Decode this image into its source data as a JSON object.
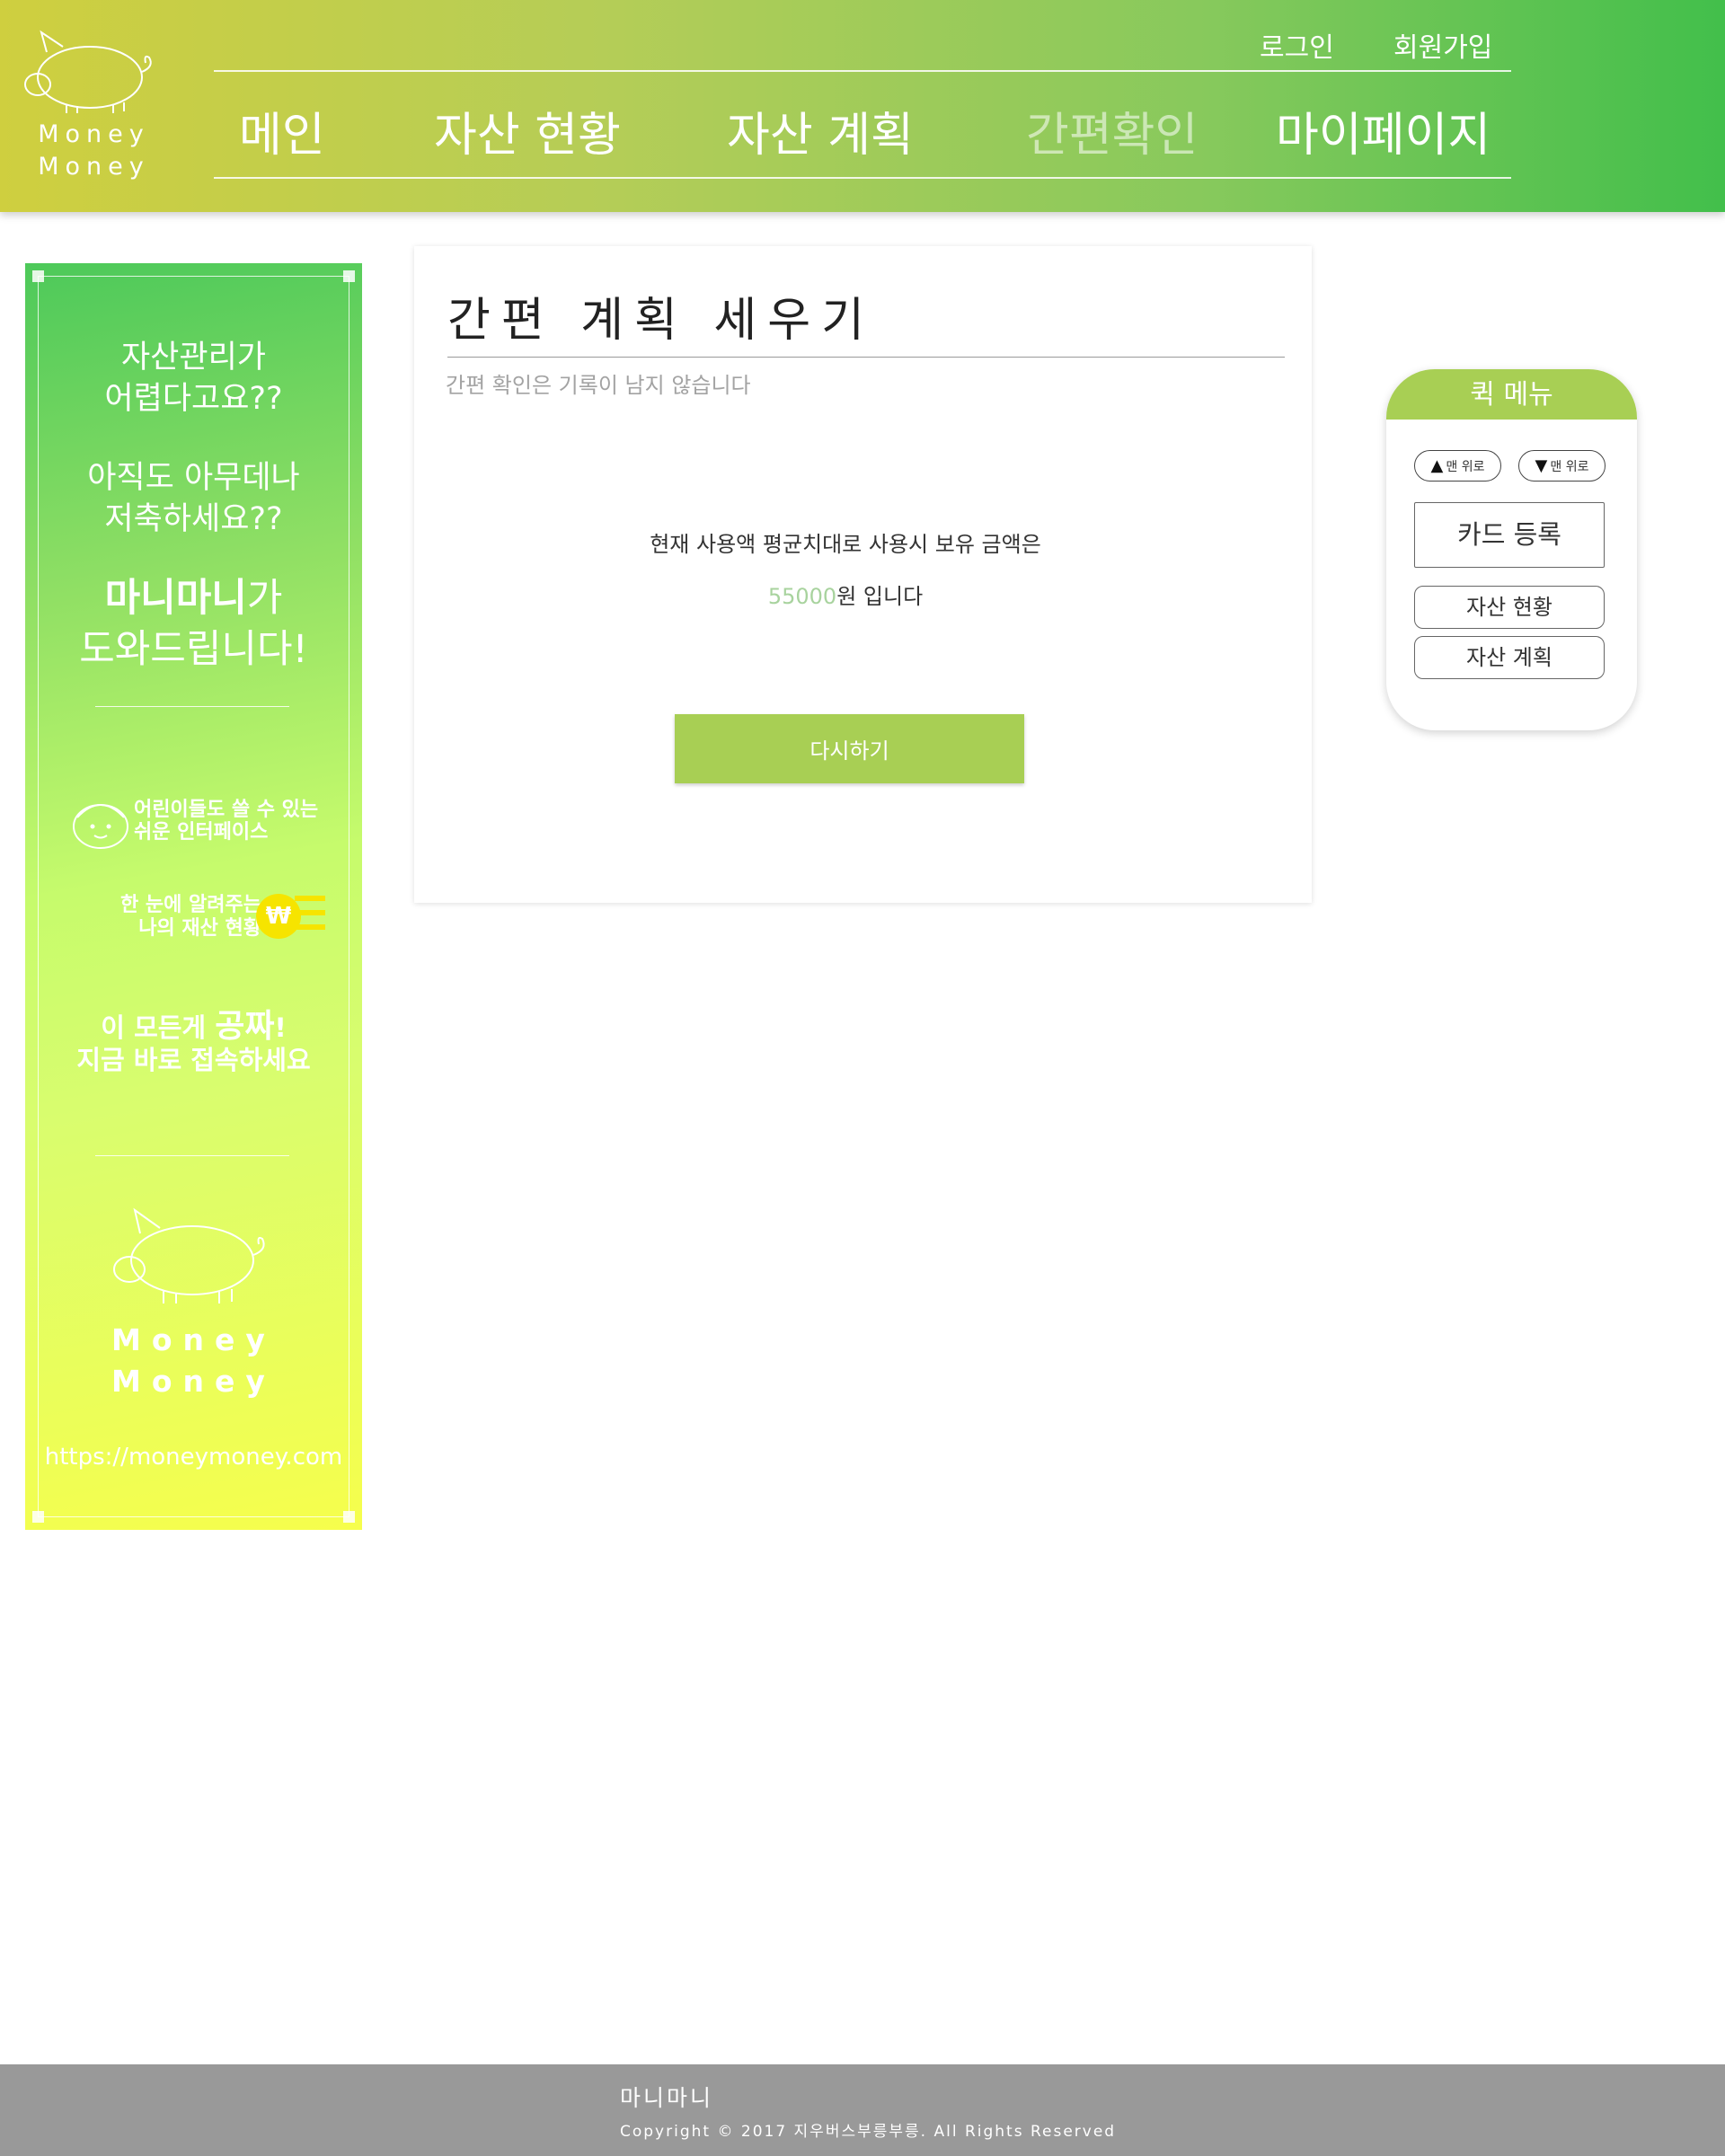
{
  "header": {
    "logo_line1": "Money",
    "logo_line2": "Money",
    "login": "로그인",
    "signup": "회원가입",
    "nav": [
      "메인",
      "자산 현황",
      "자산 계획",
      "간편확인",
      "마이페이지"
    ],
    "active_nav": "간편확인",
    "gradient": [
      "#cfcf3f",
      "#42bf4b"
    ]
  },
  "banner": {
    "line1": "자산관리가",
    "line2": "어렵다고요??",
    "line3": "아직도 아무데나",
    "line4": "저축하세요??",
    "brand": "마니마니",
    "brand_suffix": "가",
    "line6": "도와드립니다!",
    "feature1_a": "어린이들도 쓸 수 있는",
    "feature1_b": "쉬운 인터페이스",
    "feature2_a": "한 눈에 알려주는",
    "feature2_b": "나의 재산 현황",
    "won_symbol": "₩",
    "cta_a": "이 모든게 ",
    "cta_em": "공짜",
    "cta_a_end": "!",
    "cta_b": "지금 바로 접속하세요",
    "logo_line1": "Money",
    "logo_line2": "Money",
    "url": "https://moneymoney.com"
  },
  "card": {
    "title": "간편 계획 세우기",
    "subtitle": "간편 확인은 기록이 남지 않습니다",
    "line1": "현재 사용액 평균치대로 사용시 보유 금액은",
    "amount": "55000",
    "amount_suffix": "원 입니다",
    "retry_button": "다시하기",
    "accent_color": "#a8cf54"
  },
  "quick_menu": {
    "title": "퀵 메뉴",
    "up_label": "맨 위로",
    "down_label": "맨 위로",
    "up_icon": "▲",
    "down_icon": "▼",
    "card_register": "카드 등록",
    "asset_status": "자산 현황",
    "asset_plan": "자산 계획"
  },
  "footer": {
    "name": "마니마니",
    "copyright": "Copyright © 2017 지우버스부릉부릉. All Rights Reserved",
    "background": "#999999"
  }
}
